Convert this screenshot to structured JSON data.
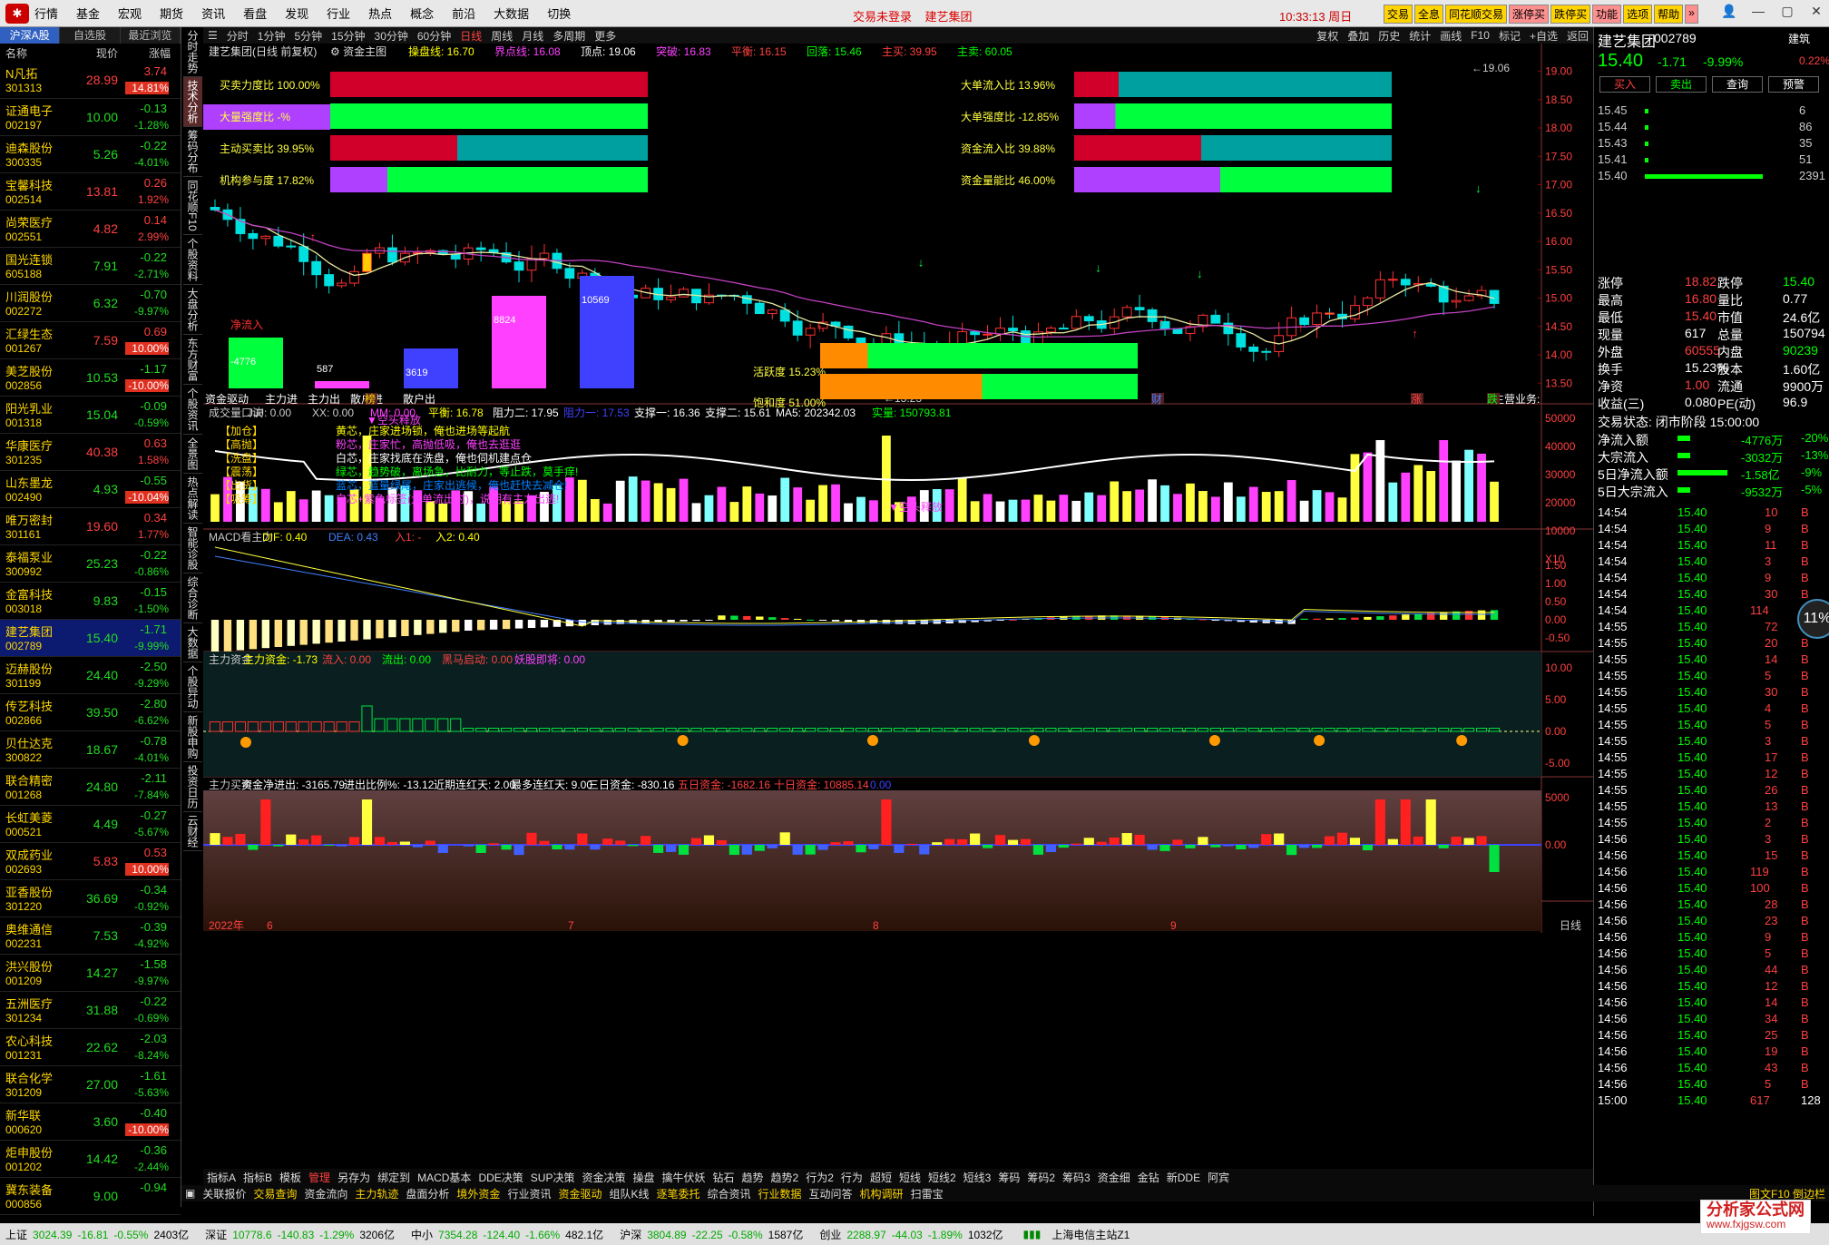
{
  "menu": {
    "items": [
      "行情",
      "基金",
      "宏观",
      "期货",
      "资讯",
      "看盘",
      "发现",
      "行业",
      "热点",
      "概念",
      "前沿",
      "大数据",
      "切换"
    ],
    "status": "交易未登录",
    "stock": "建艺集团",
    "clock": "10:33:13",
    "weekday": "周日",
    "hot": [
      "交易",
      "全息",
      "同花顺交易",
      "涨停买",
      "跌停买",
      "功能",
      "选项",
      "帮助",
      "»"
    ]
  },
  "list": {
    "tabs": [
      "沪深A股",
      "自选股",
      "最近浏览"
    ],
    "head": [
      "名称",
      "现价",
      "涨幅"
    ],
    "rows": [
      {
        "n": "N凡拓",
        "c": "301313",
        "p": "28.99",
        "ch": "3.74",
        "pc": "14.81%",
        "t": "lim"
      },
      {
        "n": "证通电子",
        "c": "002197",
        "p": "10.00",
        "ch": "-0.13",
        "pc": "-1.28%",
        "t": "dn"
      },
      {
        "n": "迪森股份",
        "c": "300335",
        "p": "5.26",
        "ch": "-0.22",
        "pc": "-4.01%",
        "t": "dn"
      },
      {
        "n": "宝馨科技",
        "c": "002514",
        "p": "13.81",
        "ch": "0.26",
        "pc": "1.92%",
        "t": "up"
      },
      {
        "n": "尚荣医疗",
        "c": "002551",
        "p": "4.82",
        "ch": "0.14",
        "pc": "2.99%",
        "t": "up"
      },
      {
        "n": "国光连锁",
        "c": "605188",
        "p": "7.91",
        "ch": "-0.22",
        "pc": "-2.71%",
        "t": "dn"
      },
      {
        "n": "川润股份",
        "c": "002272",
        "p": "6.32",
        "ch": "-0.70",
        "pc": "-9.97%",
        "t": "dnlim"
      },
      {
        "n": "汇绿生态",
        "c": "001267",
        "p": "7.59",
        "ch": "0.69",
        "pc": "10.00%",
        "t": "lim"
      },
      {
        "n": "美芝股份",
        "c": "002856",
        "p": "10.53",
        "ch": "-1.17",
        "pc": "-10.00%",
        "t": "dnlim"
      },
      {
        "n": "阳光乳业",
        "c": "001318",
        "p": "15.04",
        "ch": "-0.09",
        "pc": "-0.59%",
        "t": "dn"
      },
      {
        "n": "华康医疗",
        "c": "301235",
        "p": "40.38",
        "ch": "0.63",
        "pc": "1.58%",
        "t": "up"
      },
      {
        "n": "山东墨龙",
        "c": "002490",
        "p": "4.93",
        "ch": "-0.55",
        "pc": "-10.04%",
        "t": "dnlim"
      },
      {
        "n": "唯万密封",
        "c": "301161",
        "p": "19.60",
        "ch": "0.34",
        "pc": "1.77%",
        "t": "up"
      },
      {
        "n": "泰福泵业",
        "c": "300992",
        "p": "25.23",
        "ch": "-0.22",
        "pc": "-0.86%",
        "t": "dn"
      },
      {
        "n": "金富科技",
        "c": "003018",
        "p": "9.83",
        "ch": "-0.15",
        "pc": "-1.50%",
        "t": "dn"
      },
      {
        "n": "建艺集团",
        "c": "002789",
        "p": "15.40",
        "ch": "-1.71",
        "pc": "-9.99%",
        "t": "dnlim",
        "sel": true
      },
      {
        "n": "迈赫股份",
        "c": "301199",
        "p": "24.40",
        "ch": "-2.50",
        "pc": "-9.29%",
        "t": "dnlim"
      },
      {
        "n": "传艺科技",
        "c": "002866",
        "p": "39.50",
        "ch": "-2.80",
        "pc": "-6.62%",
        "t": "dnlim"
      },
      {
        "n": "贝仕达克",
        "c": "300822",
        "p": "18.67",
        "ch": "-0.78",
        "pc": "-4.01%",
        "t": "dn"
      },
      {
        "n": "联合精密",
        "c": "001268",
        "p": "24.80",
        "ch": "-2.11",
        "pc": "-7.84%",
        "t": "dnlim"
      },
      {
        "n": "长虹美菱",
        "c": "000521",
        "p": "4.49",
        "ch": "-0.27",
        "pc": "-5.67%",
        "t": "dnlim"
      },
      {
        "n": "双成药业",
        "c": "002693",
        "p": "5.83",
        "ch": "0.53",
        "pc": "10.00%",
        "t": "lim"
      },
      {
        "n": "亚香股份",
        "c": "301220",
        "p": "36.69",
        "ch": "-0.34",
        "pc": "-0.92%",
        "t": "dn"
      },
      {
        "n": "奥维通信",
        "c": "002231",
        "p": "7.53",
        "ch": "-0.39",
        "pc": "-4.92%",
        "t": "dnlim"
      },
      {
        "n": "洪兴股份",
        "c": "001209",
        "p": "14.27",
        "ch": "-1.58",
        "pc": "-9.97%",
        "t": "dnlim"
      },
      {
        "n": "五洲医疗",
        "c": "301234",
        "p": "31.88",
        "ch": "-0.22",
        "pc": "-0.69%",
        "t": "dn"
      },
      {
        "n": "农心科技",
        "c": "001231",
        "p": "22.62",
        "ch": "-2.03",
        "pc": "-8.24%",
        "t": "dnlim"
      },
      {
        "n": "联合化学",
        "c": "301209",
        "p": "27.00",
        "ch": "-1.61",
        "pc": "-5.63%",
        "t": "dnlim"
      },
      {
        "n": "新华联",
        "c": "000620",
        "p": "3.60",
        "ch": "-0.40",
        "pc": "-10.00%",
        "t": "dnlim"
      },
      {
        "n": "炬申股份",
        "c": "001202",
        "p": "14.42",
        "ch": "-0.36",
        "pc": "-2.44%",
        "t": "dn"
      },
      {
        "n": "冀东装备",
        "c": "000856",
        "p": "9.00",
        "ch": "-0.94",
        "pc": "",
        "t": "dn"
      }
    ]
  },
  "vtabs": [
    "分时走势",
    "技术分析",
    "筹码分布",
    "同花顺F10",
    "个股资料",
    "大盘分析",
    "东方财富",
    "个股资讯",
    "全景图",
    "热点解读",
    "智能诊股",
    "综合诊断",
    "大数据",
    "个股异动",
    "新股申购",
    "投资日历",
    "云财经"
  ],
  "chart": {
    "toolbar": [
      "分时",
      "1分钟",
      "5分钟",
      "15分钟",
      "30分钟",
      "60分钟",
      "日线",
      "周线",
      "月线",
      "多周期",
      "更多"
    ],
    "toolbar_right": [
      "复权",
      "叠加",
      "历史",
      "统计",
      "画线",
      "F10",
      "标记",
      "+自选",
      "返回"
    ],
    "title": "建艺集团(日线 前复权)",
    "subtitle": "资金主图",
    "info": [
      {
        "l": "操盘线:",
        "v": "16.70",
        "c": "#ffff00"
      },
      {
        "l": "界点线:",
        "v": "16.08",
        "c": "#ff40ff"
      },
      {
        "l": "顶点:",
        "v": "19.06",
        "c": "#fff"
      },
      {
        "l": "突破:",
        "v": "16.83",
        "c": "#ff40ff"
      },
      {
        "l": "平衡:",
        "v": "16.15",
        "c": "#ff4040"
      },
      {
        "l": "回落:",
        "v": "15.46",
        "c": "#00ff00"
      },
      {
        "l": "主买:",
        "v": "39.95",
        "c": "#ff4040"
      },
      {
        "l": "主卖:",
        "v": "60.05",
        "c": "#00ff00"
      }
    ],
    "y_main": [
      "19.00",
      "18.50",
      "18.00",
      "17.50",
      "17.00",
      "16.50",
      "16.00",
      "15.50",
      "15.00",
      "14.50",
      "14.00",
      "13.50"
    ],
    "bars_left": [
      {
        "l": "买卖力度比",
        "v": "100.00%",
        "f": 1.0,
        "c1": "#d0002a",
        "c2": "#d0002a"
      },
      {
        "l": "大量强度比",
        "v": "-%",
        "f": 0.0,
        "c1": "#b040ff",
        "c2": "#00ff3c"
      },
      {
        "l": "主动买卖比",
        "v": "39.95%",
        "f": 0.4,
        "c1": "#d0002a",
        "c2": "#00a0a0"
      },
      {
        "l": "机构参与度",
        "v": "17.82%",
        "f": 0.18,
        "c1": "#b040ff",
        "c2": "#00ff3c"
      }
    ],
    "bars_right": [
      {
        "l": "大单流入比",
        "v": "13.96%",
        "f": 0.14,
        "c1": "#d0002a",
        "c2": "#00a0a0"
      },
      {
        "l": "大单强度比",
        "v": "-12.85%",
        "f": 0.13,
        "c1": "#b040ff",
        "c2": "#00ff3c"
      },
      {
        "l": "资金流入比",
        "v": "39.88%",
        "f": 0.4,
        "c1": "#d0002a",
        "c2": "#00a0a0"
      },
      {
        "l": "资金量能比",
        "v": "46.00%",
        "f": 0.46,
        "c1": "#b040ff",
        "c2": "#00ff3c"
      }
    ],
    "active": {
      "l": "活跃度",
      "v": "15.23%",
      "f": 0.15
    },
    "saturate": {
      "l": "饱和度",
      "v": "51.00%",
      "f": 0.51
    },
    "netin_label": "净流入",
    "blocks": [
      {
        "v": "-4776",
        "c": "#00ff3c"
      },
      {
        "v": "587",
        "c": "#ff40ff"
      },
      {
        "v": "3619",
        "c": "#4040ff"
      },
      {
        "v": "8824",
        "c": "#ff40ff"
      },
      {
        "v": "10569",
        "c": "#4040ff"
      }
    ],
    "block_labels": [
      "资金驱动",
      "主力进",
      "主力出",
      "散户进",
      "散户出"
    ],
    "low_label": "13.23",
    "high_label": "19.06",
    "main_business": "主营业务:",
    "marks": [
      "榜",
      "财",
      "涨",
      "跌"
    ],
    "vol_hdr": [
      {
        "t": "成交量口诀",
        "c": "#ccc"
      },
      {
        "t": "JJJ: 0.00",
        "c": "#ccc"
      },
      {
        "t": "XX: 0.00",
        "c": "#ccc"
      },
      {
        "t": "MM: 0.00",
        "c": "#ff40ff"
      },
      {
        "t": "平衡: 16.78",
        "c": "#ffff00"
      },
      {
        "t": "阻力二: 17.95",
        "c": "#fff"
      },
      {
        "t": "阻力一: 17.53",
        "c": "#4040ff"
      },
      {
        "t": "支撑一: 16.36",
        "c": "#fff"
      },
      {
        "t": "支撑二: 15.61",
        "c": "#fff"
      },
      {
        "t": "MA5: 202342.03",
        "c": "#fff"
      },
      {
        "t": "实量: 150793.81",
        "c": "#00ff00"
      }
    ],
    "vol_y": [
      "50000",
      "40000",
      "30000",
      "20000",
      "10000",
      "X10"
    ],
    "legend": [
      {
        "k": "【加仓】",
        "t": "黄芯，庄家进场锁，俺也进场等起航",
        "c": "#ffff00"
      },
      {
        "k": "【高抛】",
        "t": "粉芯，庄家忙，高抛低吸，俺也去逛逛",
        "c": "#ff40ff"
      },
      {
        "k": "【洗盘】",
        "t": "白芯，庄家找底在洗盘，俺也伺机建点仓",
        "c": "#ffffff"
      },
      {
        "k": "【震荡】",
        "t": "绿芯，趋势破，离场急，比耐力，等止跌，莫手痒!",
        "c": "#00ff00"
      },
      {
        "k": "【出货】",
        "t": "蓝芯，蓝量绿尾，庄家出逃候，俺也赶快去减仓!",
        "c": "#0080ff"
      },
      {
        "k": "【吸筹】",
        "t": "白芯+紫色标签(大单流出时)，说明有主力出逃!",
        "c": "#ff40ff"
      }
    ],
    "vol_tags": [
      "空头释放",
      "空头释放"
    ],
    "macd_hdr": [
      {
        "t": "MACD看主力",
        "c": "#ccc"
      },
      {
        "t": "DIF: 0.40",
        "c": "#ffff00"
      },
      {
        "t": "DEA: 0.43",
        "c": "#4080ff"
      },
      {
        "t": "入1: -",
        "c": "#ff4040"
      },
      {
        "t": "入2: 0.40",
        "c": "#ffff00"
      }
    ],
    "macd_y": [
      "1.50",
      "1.00",
      "0.50",
      "0.00",
      "-0.50"
    ],
    "mf_hdr": [
      {
        "t": "主力资金",
        "c": "#ccc"
      },
      {
        "t": "主力资金: -1.73",
        "c": "#ffff00"
      },
      {
        "t": "流入: 0.00",
        "c": "#ff4040"
      },
      {
        "t": "流出: 0.00",
        "c": "#00ff00"
      },
      {
        "t": "黑马启动: 0.00",
        "c": "#ff4040"
      },
      {
        "t": "妖股即将: 0.00",
        "c": "#ff40ff"
      }
    ],
    "mf_y": [
      "10.00",
      "5.00",
      "0.00",
      "-5.00"
    ],
    "bs_hdr": [
      {
        "t": "主力买卖",
        "c": "#ccc"
      },
      {
        "t": "资金净进出: -3165.79",
        "c": "#fff"
      },
      {
        "t": "进出比例%: -13.12",
        "c": "#fff"
      },
      {
        "t": "近期连红天: 2.00",
        "c": "#fff"
      },
      {
        "t": "最多连红天: 9.00",
        "c": "#fff"
      },
      {
        "t": "三日资金: -830.16",
        "c": "#fff"
      },
      {
        "t": "五日资金: -1682.16",
        "c": "#ff4040"
      },
      {
        "t": "十日资金: 10885.14",
        "c": "#ff4040"
      },
      {
        "t": "0.00",
        "c": "#4040ff"
      }
    ],
    "bs_y": [
      "5000",
      "0.00"
    ],
    "xaxis": [
      "2022年",
      "6",
      "7",
      "8",
      "9",
      "日线"
    ]
  },
  "bottom1": [
    "指标A",
    "指标B",
    "模板",
    "管理",
    "另存为",
    "绑定到",
    "MACD基本",
    "DDE决策",
    "SUP决策",
    "资金决策",
    "操盘",
    "擒牛伏妖",
    "钻石",
    "趋势",
    "趋势2",
    "行为2",
    "行为",
    "超短",
    "短线",
    "短线2",
    "短线3",
    "筹码",
    "筹码2",
    "筹码3",
    "资金细",
    "金钻",
    "新DDE",
    "阿宾"
  ],
  "bottom2": [
    "关联报价",
    "交易查询",
    "资金流向",
    "主力轨迹",
    "盘面分析",
    "境外资金",
    "行业资讯",
    "资金驱动",
    "组队K线",
    "逐笔委托",
    "综合资讯",
    "行业数据",
    "互动问答",
    "机构调研",
    "扫雷宝"
  ],
  "bottom2_right": "图文F10 倒边栏",
  "right": {
    "name": "建艺集团",
    "code": "002789",
    "tag": "建筑",
    "price": "15.40",
    "chg": "-1.71",
    "pct": "-9.99%",
    "wei": "0.22%",
    "btns": [
      "买入",
      "卖出",
      "查询",
      "预警"
    ],
    "bids": [
      {
        "p": "15.45",
        "v": "6"
      },
      {
        "p": "15.44",
        "v": "86"
      },
      {
        "p": "15.43",
        "v": "35"
      },
      {
        "p": "15.41",
        "v": "51"
      },
      {
        "p": "15.40",
        "v": "2391"
      }
    ],
    "stats": [
      [
        "涨停",
        "18.82",
        "跌停",
        "15.40"
      ],
      [
        "最高",
        "16.80",
        "量比",
        "0.77"
      ],
      [
        "最低",
        "15.40",
        "市值",
        "24.6亿"
      ],
      [
        "现量",
        "617",
        "总量",
        "150794"
      ],
      [
        "外盘",
        "60555",
        "内盘",
        "90239"
      ],
      [
        "换手",
        "15.23%",
        "股本",
        "1.60亿"
      ],
      [
        "净资",
        "1.00",
        "流通",
        "9900万"
      ],
      [
        "收益(三)",
        "0.080",
        "PE(动)",
        "96.9"
      ]
    ],
    "trade_status": "交易状态: 闭市阶段 15:00:00",
    "flows": [
      [
        "净流入额",
        "-4776万",
        "-20%"
      ],
      [
        "大宗流入",
        "-3032万",
        "-13%"
      ],
      [
        "5日净流入额",
        "-1.58亿",
        "-9%"
      ],
      [
        "5日大宗流入",
        "-9532万",
        "-5%"
      ]
    ],
    "ticks": [
      [
        "14:54",
        "15.40",
        "10",
        "B"
      ],
      [
        "14:54",
        "15.40",
        "9",
        "B"
      ],
      [
        "14:54",
        "15.40",
        "11",
        "B"
      ],
      [
        "14:54",
        "15.40",
        "3",
        "B"
      ],
      [
        "14:54",
        "15.40",
        "9",
        "B"
      ],
      [
        "14:54",
        "15.40",
        "30",
        "B"
      ],
      [
        "14:54",
        "15.40",
        "114",
        "B"
      ],
      [
        "14:55",
        "15.40",
        "72",
        "B"
      ],
      [
        "14:55",
        "15.40",
        "20",
        "B"
      ],
      [
        "14:55",
        "15.40",
        "14",
        "B"
      ],
      [
        "14:55",
        "15.40",
        "5",
        "B"
      ],
      [
        "14:55",
        "15.40",
        "30",
        "B"
      ],
      [
        "14:55",
        "15.40",
        "4",
        "B"
      ],
      [
        "14:55",
        "15.40",
        "5",
        "B"
      ],
      [
        "14:55",
        "15.40",
        "3",
        "B"
      ],
      [
        "14:55",
        "15.40",
        "17",
        "B"
      ],
      [
        "14:55",
        "15.40",
        "12",
        "B"
      ],
      [
        "14:55",
        "15.40",
        "26",
        "B"
      ],
      [
        "14:55",
        "15.40",
        "13",
        "B"
      ],
      [
        "14:55",
        "15.40",
        "2",
        "B"
      ],
      [
        "14:56",
        "15.40",
        "3",
        "B"
      ],
      [
        "14:56",
        "15.40",
        "15",
        "B"
      ],
      [
        "14:56",
        "15.40",
        "119",
        "B"
      ],
      [
        "14:56",
        "15.40",
        "100",
        "B"
      ],
      [
        "14:56",
        "15.40",
        "28",
        "B"
      ],
      [
        "14:56",
        "15.40",
        "23",
        "B"
      ],
      [
        "14:56",
        "15.40",
        "9",
        "B"
      ],
      [
        "14:56",
        "15.40",
        "5",
        "B"
      ],
      [
        "14:56",
        "15.40",
        "44",
        "B"
      ],
      [
        "14:56",
        "15.40",
        "12",
        "B"
      ],
      [
        "14:56",
        "15.40",
        "14",
        "B"
      ],
      [
        "14:56",
        "15.40",
        "34",
        "B"
      ],
      [
        "14:56",
        "15.40",
        "25",
        "B"
      ],
      [
        "14:56",
        "15.40",
        "19",
        "B"
      ],
      [
        "14:56",
        "15.40",
        "43",
        "B"
      ],
      [
        "14:56",
        "15.40",
        "5",
        "B"
      ],
      [
        "15:00",
        "15.40",
        "617",
        "128"
      ]
    ],
    "badge": "11%"
  },
  "status": {
    "items": [
      {
        "t": "上证",
        "v": "3024.39",
        "d": "-16.81",
        "p": "-0.55%",
        "a": "2403亿"
      },
      {
        "t": "深证",
        "v": "10778.6",
        "d": "-140.83",
        "p": "-1.29%",
        "a": "3206亿"
      },
      {
        "t": "中小",
        "v": "7354.28",
        "d": "-124.40",
        "p": "-1.66%",
        "a": "482.1亿"
      },
      {
        "t": "沪深",
        "v": "3804.89",
        "d": "-22.25",
        "p": "-0.58%",
        "a": "1587亿"
      },
      {
        "t": "创业",
        "v": "2288.97",
        "d": "-44.03",
        "p": "-1.89%",
        "a": "1032亿"
      }
    ],
    "server": "上海电信主站Z1",
    "brand": "分析家公式网",
    "brand_url": "www.fxjgsw.com"
  },
  "chart_data": {
    "type": "candlestick",
    "title": "建艺集团(日线 前复权)",
    "y_range": [
      13.2,
      19.2
    ],
    "high": 19.06,
    "low": 13.23,
    "last": 15.4,
    "xticks": [
      "2022年",
      "6",
      "7",
      "8",
      "9"
    ]
  }
}
